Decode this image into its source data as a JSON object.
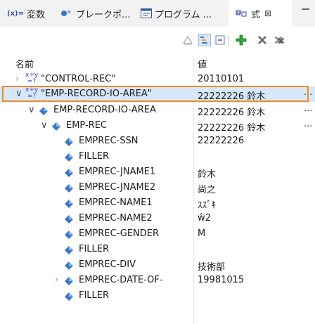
{
  "tabs": [
    {
      "label": "変数",
      "prefix": "(x)="
    },
    {
      "label": "ブレークポ..."
    },
    {
      "label": "プログラム ..."
    },
    {
      "label": "式",
      "close": "⊠"
    }
  ],
  "table": {
    "header_name": "名前",
    "header_value": "値"
  },
  "rows": [
    {
      "name": "\"CONTROL-REC\"",
      "value": "20110101"
    },
    {
      "name": "\"EMP-RECORD-IO-AREA\"",
      "value": "22222226 鈴木",
      "dots": "..."
    },
    {
      "name": "EMP-RECORD-IO-AREA",
      "value": "22222226 鈴木",
      "dots": "..."
    },
    {
      "name": "EMP-REC",
      "value": "22222226 鈴木",
      "dots": "..."
    },
    {
      "name": "EMPREC-SSN",
      "value": "22222226"
    },
    {
      "name": "FILLER",
      "value": ""
    },
    {
      "name": "EMPREC-JNAME1",
      "value": "鈴木"
    },
    {
      "name": "EMPREC-JNAME2",
      "value": "尚之"
    },
    {
      "name": "EMPREC-NAME1",
      "value": "ｽｽﾞｷ"
    },
    {
      "name": "EMPREC-NAME2",
      "value": "ŵ2"
    },
    {
      "name": "EMPREC-GENDER",
      "value": "M"
    },
    {
      "name": "FILLER",
      "value": ""
    },
    {
      "name": "EMPREC-DIV",
      "value": "技術部"
    },
    {
      "name": "EMPREC-DATE-OF-",
      "value": "19981015"
    },
    {
      "name": "FILLER",
      "value": ""
    }
  ],
  "colors": {
    "accent_highlight": "#f08a24",
    "selection": "#d6e8fa",
    "diamond": "#3a78c8",
    "expression_icon": "#3548b0",
    "add_green": "#35a035"
  }
}
